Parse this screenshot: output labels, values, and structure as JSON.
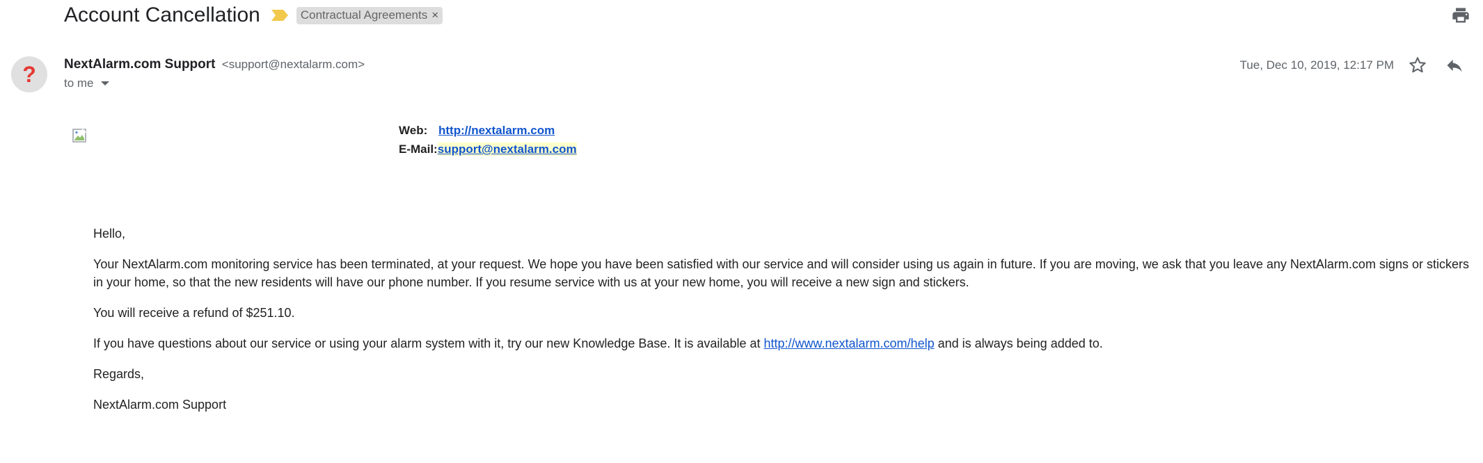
{
  "email": {
    "subject": "Account Cancellation",
    "label": "Contractual Agreements",
    "label_remove": "×",
    "sender": {
      "name": "NextAlarm.com Support",
      "email": "<support@nextalarm.com>",
      "avatar_glyph": "?"
    },
    "recipient": "to me",
    "date": "Tue, Dec 10, 2019, 12:17 PM"
  },
  "header_block": {
    "web_label": "Web:",
    "web_link": "http://nextalarm.com",
    "email_label": "E-Mail:",
    "email_link": "support@nextalarm.com"
  },
  "body": {
    "greeting": "Hello,",
    "paragraph1": "Your NextAlarm.com monitoring service has been terminated, at your request. We hope you have been satisfied with our service and will consider using us again in future. If you are moving, we ask that you leave any NextAlarm.com signs or stickers in your home, so that the new residents will have our phone number. If you resume service with us at your new home, you will receive a new sign and stickers.",
    "refund": "You will receive a refund of $251.10.",
    "kb_before": "If you have questions about our service or using your alarm system with it, try our new Knowledge Base. It is available at ",
    "kb_link": "http://www.nextalarm.com/help",
    "kb_after": " and is always being added to.",
    "closing": "Regards,",
    "signature": "NextAlarm.com Support"
  },
  "icons": {
    "importance": "importance-marker-icon",
    "print": "print-icon",
    "star": "star-icon",
    "reply": "reply-icon",
    "caret": "chevron-down-icon",
    "broken_image": "broken-image-icon"
  },
  "colors": {
    "link": "#1155cc",
    "importance": "#f2c94c",
    "avatar_bg": "#e0e0e0",
    "avatar_glyph": "#e53935",
    "label_bg": "#dddddd",
    "highlight": "#ffffcc"
  }
}
